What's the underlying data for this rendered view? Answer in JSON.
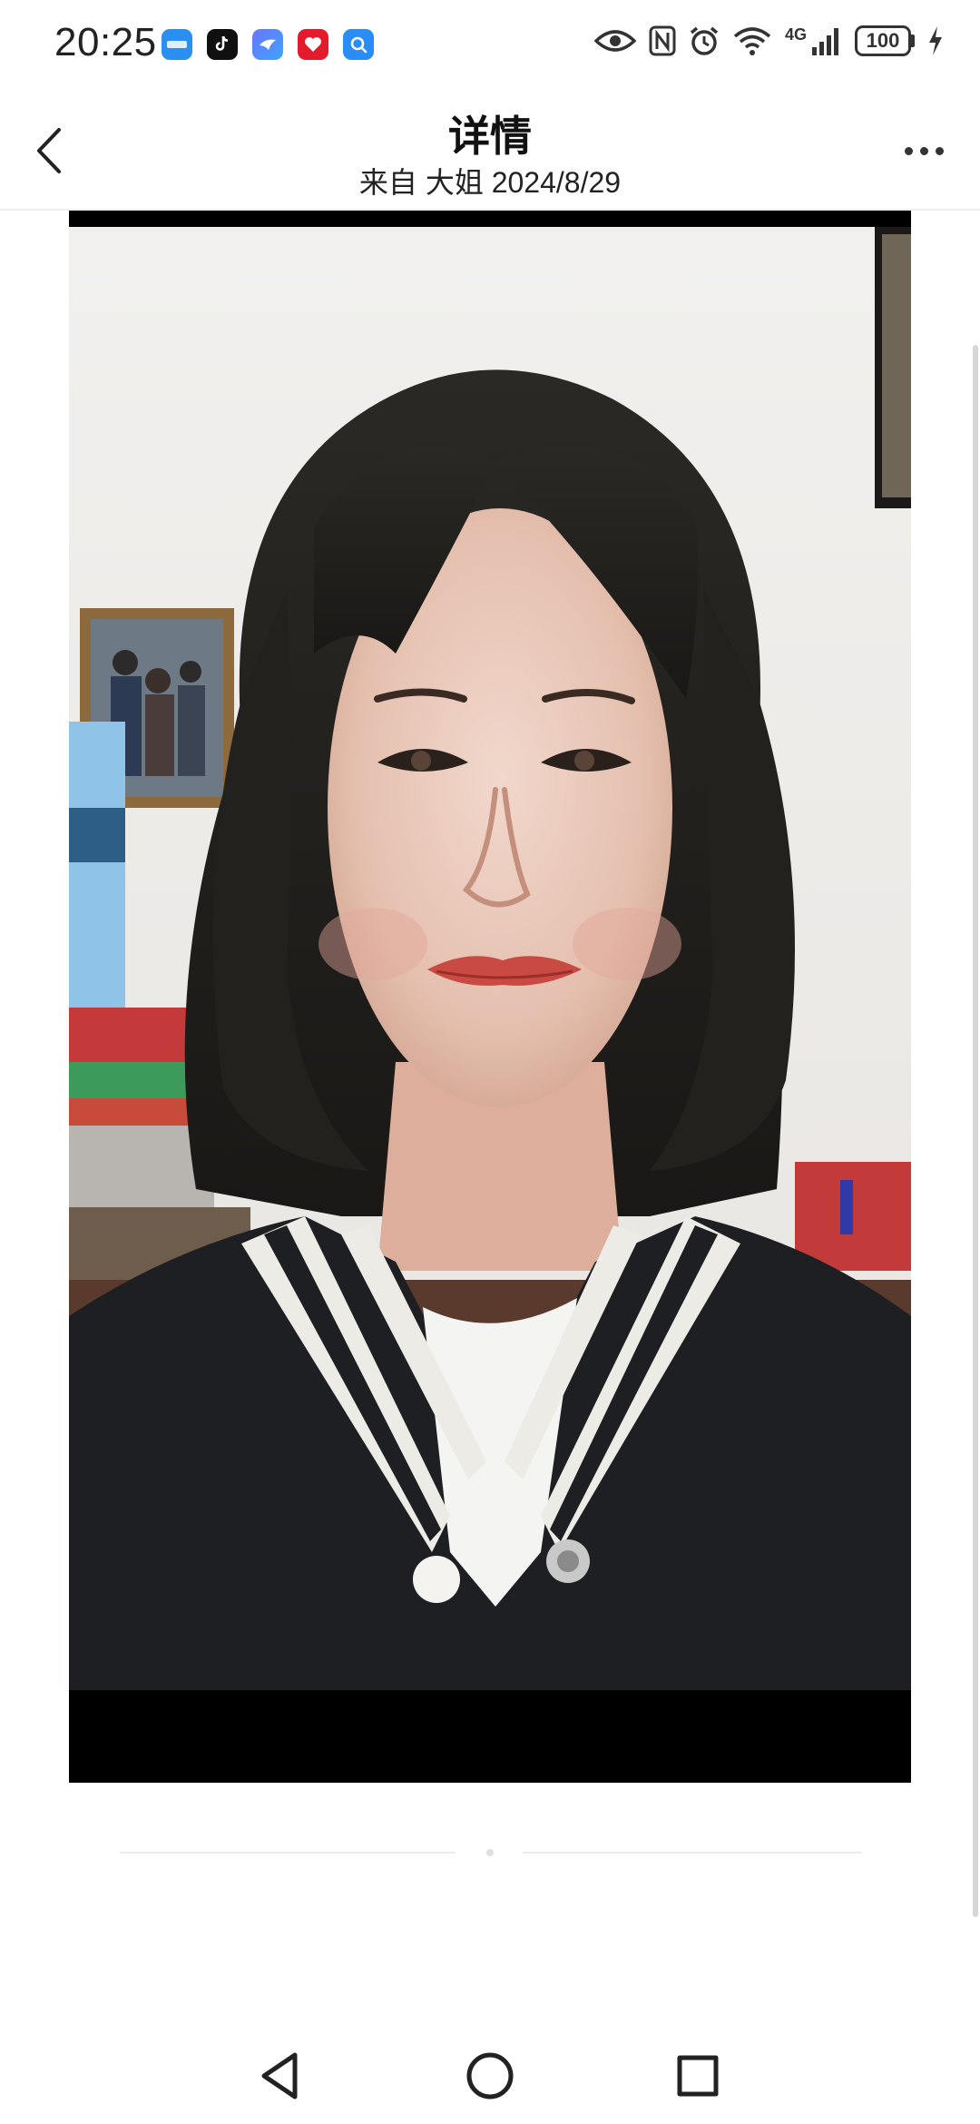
{
  "status_bar": {
    "time": "20:25",
    "network": "4G",
    "battery": "100",
    "notification_icons": [
      "video-app-icon",
      "tiktok-icon",
      "bird-app-icon",
      "red-app-icon",
      "search-app-icon"
    ],
    "system_icons": [
      "eye-icon",
      "nfc-icon",
      "alarm-icon",
      "wifi-icon",
      "signal-icon",
      "battery-icon",
      "charging-icon"
    ]
  },
  "header": {
    "title": "详情",
    "subtitle": "来自 大姐 2024/8/29"
  },
  "photo": {
    "description_icon": "portrait-photo"
  },
  "nav_bar": {
    "buttons": [
      "nav-back-icon",
      "nav-home-icon",
      "nav-recent-icon"
    ]
  },
  "colors": {
    "background": "#ffffff",
    "frame": "#000000",
    "text": "#111111"
  }
}
